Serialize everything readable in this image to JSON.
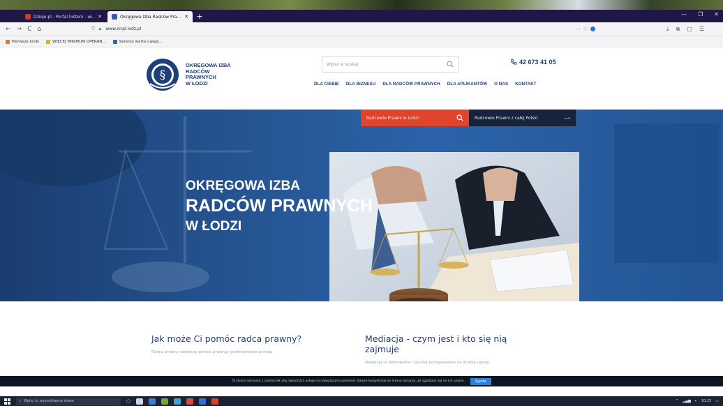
{
  "browser": {
    "tabs": [
      {
        "title": "Dzieje.pl - Portal historii - wi...",
        "fav_color": "#d6372b",
        "active": false
      },
      {
        "title": "Okręgowa Izba Radców Pra...",
        "fav_color": "#3a5ca8",
        "active": true
      }
    ],
    "new_tab": "+",
    "window_controls": [
      "—",
      "❐",
      "✕"
    ],
    "nav": {
      "back": "←",
      "forward": "→",
      "reload": "C",
      "home": "⌂"
    },
    "url": "www.oirpl.lodz.pl",
    "url_actions": [
      "···",
      "♡"
    ],
    "toolbar_icons": [
      "⤓",
      "⧉",
      "▢",
      "☰"
    ],
    "bookmarks": [
      {
        "label": "Pierwsze kroki",
        "color": "#e6762d"
      },
      {
        "label": "WIĘCEJ MINIMUM OPERAN...",
        "color": "#e0b421"
      },
      {
        "label": "Serwisy warte uwagi...",
        "color": "#3662b8"
      }
    ]
  },
  "site": {
    "logo_lines": [
      "OKRĘGOWA IZBA",
      "RADCÓW PRAWNYCH",
      "W ŁODZI"
    ],
    "search_placeholder": "Wpisz w szukaj",
    "phone": "42 673 41 05",
    "menu": [
      "DLA CIEBIE",
      "DLA BIZNESU",
      "DLA RADCÓW PRAWNYCH",
      "DLA APLIKANTÓW",
      "O NAS",
      "KONTAKT"
    ]
  },
  "hero": {
    "btn_local": "Radcowie Prawni w Łodzi",
    "btn_all": "Radcowie Prawni z całej Polski",
    "title_l1": "OKRĘGOWA IZBA",
    "title_l2": "RADCÓW PRAWNYCH",
    "title_l3": "W ŁODZI"
  },
  "articles": [
    {
      "title": "Jak może Ci pomóc radca prawny?",
      "excerpt": "Radca prawny świadczy pomoc prawną i profesjonalnie porada"
    },
    {
      "title": "Mediacja - czym jest i kto się nią zajmuje",
      "excerpt": "Mediacja to dobrowolne i poufne postępowanie na drodze ugody"
    }
  ],
  "cookie": {
    "text": "Ta strona korzysta z ciasteczek aby świadczyć usługi na najwyższym poziomie. Dalsze korzystanie ze strony oznacza, że zgadzasz się na ich użycie.",
    "ok": "Zgoda"
  },
  "taskbar": {
    "search_placeholder": "Wpisz tu wyszukiwane słowo",
    "apps": [
      "#cfd6e2",
      "#3a7bd5",
      "#6fa83b",
      "#3ba3d8",
      "#e04a2f",
      "#2f6fd6",
      "#d4422d"
    ],
    "tray_time": "10:25"
  },
  "colors": {
    "brand_navy": "#1e3f7a",
    "hero_blue": "#24528e",
    "accent_red": "#e0442c"
  }
}
